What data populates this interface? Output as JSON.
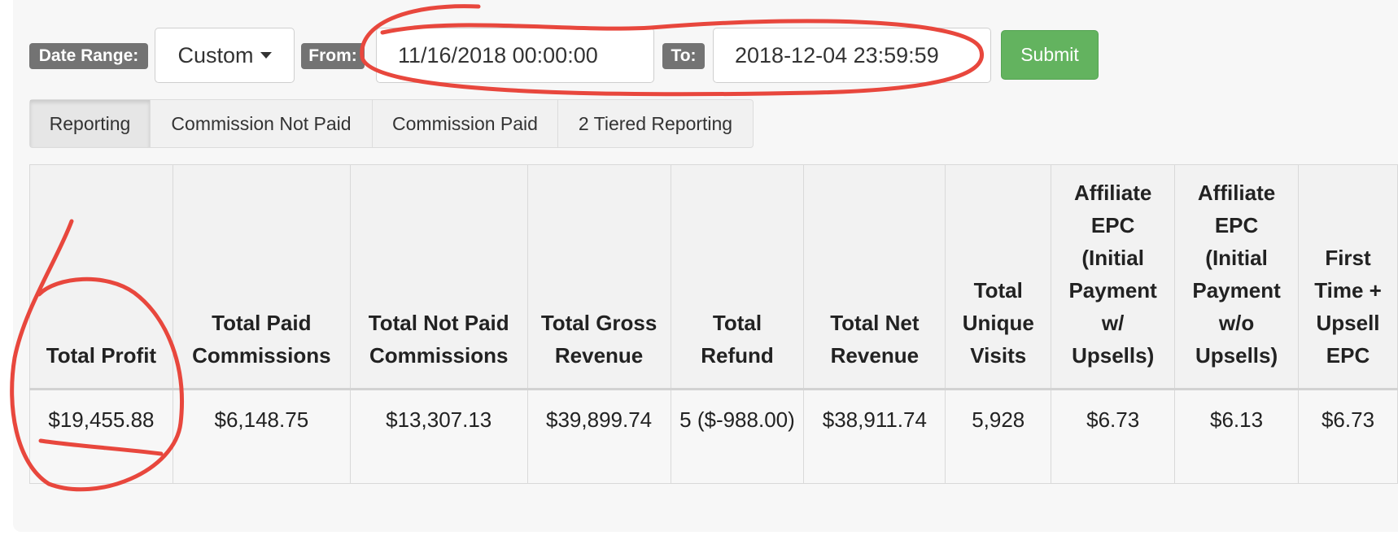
{
  "filters": {
    "date_range_label": "Date Range:",
    "date_range_value": "Custom",
    "from_label": "From:",
    "from_value": "11/16/2018 00:00:00",
    "to_label": "To:",
    "to_value": "2018-12-04 23:59:59",
    "submit_label": "Submit"
  },
  "tabs": [
    {
      "label": "Reporting",
      "active": true
    },
    {
      "label": "Commission Not Paid"
    },
    {
      "label": "Commission Paid"
    },
    {
      "label": "2 Tiered Reporting"
    }
  ],
  "table": {
    "headers": [
      "Total Profit",
      "Total Paid Commissions",
      "Total Not Paid Commissions",
      "Total Gross Revenue",
      "Total Refund",
      "Total Net Revenue",
      "Total Unique Visits",
      "Affiliate EPC (Initial Payment w/ Upsells)",
      "Affiliate EPC (Initial Payment w/o Upsells)",
      "First Time + Upsell EPC"
    ],
    "row": [
      "$19,455.88",
      "$6,148.75",
      "$13,307.13",
      "$39,899.74",
      "5 ($-988.00)",
      "$38,911.74",
      "5,928",
      "$6.73",
      "$6.13",
      "$6.73"
    ]
  },
  "colors": {
    "submit": "#63b35f",
    "label_badge": "#737373",
    "annotation": "#e8473d"
  },
  "icons": {
    "dropdown": "caret-down-icon"
  }
}
